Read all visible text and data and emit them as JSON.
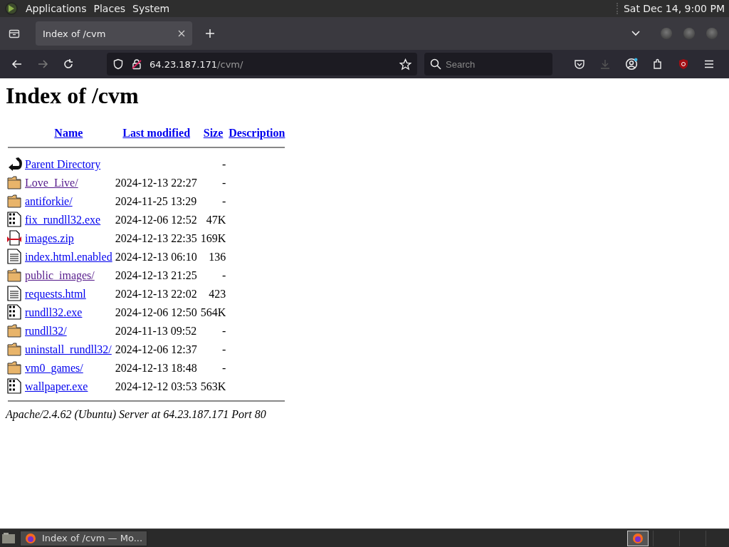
{
  "top_panel": {
    "menus": [
      "Applications",
      "Places",
      "System"
    ],
    "clock": "Sat Dec 14,  9:00 PM"
  },
  "tabs": [
    {
      "title": "Index of /cvm",
      "selected": true
    }
  ],
  "address": {
    "host": "64.23.187.171",
    "path": "/cvm/"
  },
  "search": {
    "placeholder": "Search"
  },
  "page": {
    "heading": "Index of /cvm",
    "columns": [
      "Name",
      "Last modified",
      "Size",
      "Description"
    ],
    "entries": [
      {
        "kind": "back",
        "name": "Parent Directory",
        "visited": false,
        "size": "-"
      },
      {
        "kind": "folder",
        "name": "Love_Live/",
        "visited": true,
        "modified": "2024-12-13 22:27",
        "size": "-"
      },
      {
        "kind": "folder",
        "name": "antiforkie/",
        "visited": false,
        "modified": "2024-11-25 13:29",
        "size": "-"
      },
      {
        "kind": "binary",
        "name": "fix_rundll32.exe",
        "visited": false,
        "modified": "2024-12-06 12:52",
        "size": "47K"
      },
      {
        "kind": "archive",
        "name": "images.zip",
        "visited": false,
        "modified": "2024-12-13 22:35",
        "size": "169K"
      },
      {
        "kind": "text",
        "name": "index.html.enabled",
        "visited": false,
        "modified": "2024-12-13 06:10",
        "size": "136"
      },
      {
        "kind": "folder",
        "name": "public_images/",
        "visited": true,
        "modified": "2024-12-13 21:25",
        "size": "-"
      },
      {
        "kind": "text",
        "name": "requests.html",
        "visited": false,
        "modified": "2024-12-13 22:02",
        "size": "423"
      },
      {
        "kind": "binary",
        "name": "rundll32.exe",
        "visited": false,
        "modified": "2024-12-06 12:50",
        "size": "564K"
      },
      {
        "kind": "folder",
        "name": "rundll32/",
        "visited": false,
        "modified": "2024-11-13 09:52",
        "size": "-"
      },
      {
        "kind": "folder",
        "name": "uninstall_rundll32/",
        "visited": false,
        "modified": "2024-12-06 12:37",
        "size": "-"
      },
      {
        "kind": "folder",
        "name": "vm0_games/",
        "visited": false,
        "modified": "2024-12-13 18:48",
        "size": "-"
      },
      {
        "kind": "binary",
        "name": "wallpaper.exe",
        "visited": false,
        "modified": "2024-12-12 03:53",
        "size": "563K"
      }
    ],
    "footer": "Apache/2.4.62 (Ubuntu) Server at 64.23.187.171 Port 80"
  },
  "taskbar": {
    "window": "Index of /cvm — Mo..."
  }
}
